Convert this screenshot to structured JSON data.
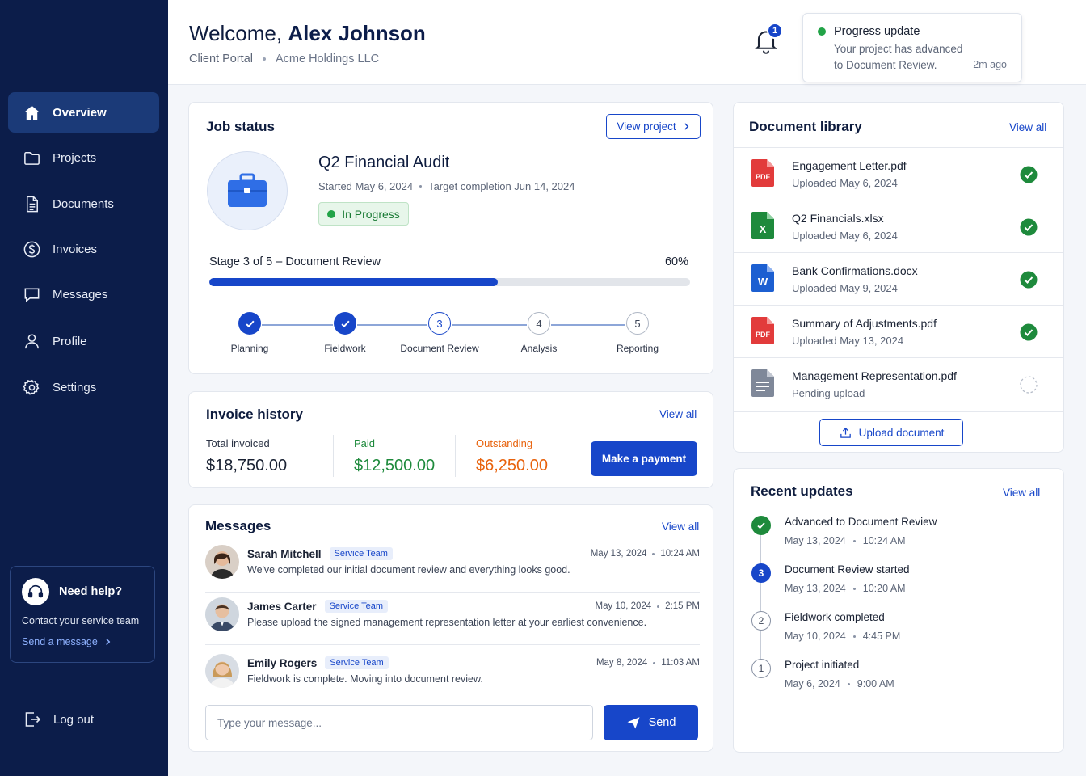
{
  "header": {
    "welcome_prefix": "Welcome,",
    "user_name": "Alex Johnson",
    "portal": "Client Portal",
    "company": "Acme Holdings LLC",
    "notification_count": "1"
  },
  "toast": {
    "title": "Progress update",
    "body": "Your project has advanced to Document Review.",
    "time": "2m ago"
  },
  "sidebar": {
    "items": [
      {
        "label": "Overview",
        "icon": "home-icon"
      },
      {
        "label": "Projects",
        "icon": "folder-icon"
      },
      {
        "label": "Documents",
        "icon": "document-icon"
      },
      {
        "label": "Invoices",
        "icon": "dollar-icon"
      },
      {
        "label": "Messages",
        "icon": "chat-icon"
      },
      {
        "label": "Profile",
        "icon": "user-icon"
      },
      {
        "label": "Settings",
        "icon": "gear-icon"
      }
    ],
    "help_title": "Need help?",
    "help_text": "Contact your service team",
    "help_link": "Send a message",
    "logout": "Log out"
  },
  "job": {
    "title": "Job status",
    "view_project": "View project",
    "name": "Q2 Financial Audit",
    "started": "Started May 6, 2024",
    "target": "Target completion Jun 14, 2024",
    "status": "In Progress",
    "stage": "Stage 3 of 5 – Document Review",
    "percent_label": "60%",
    "progress": 0.6,
    "steps": [
      {
        "label": "Planning",
        "num": "1",
        "state": "done"
      },
      {
        "label": "Fieldwork",
        "num": "2",
        "state": "done"
      },
      {
        "label": "Document Review",
        "num": "3",
        "state": "current"
      },
      {
        "label": "Analysis",
        "num": "4",
        "state": "todo"
      },
      {
        "label": "Reporting",
        "num": "5",
        "state": "todo"
      }
    ]
  },
  "invoice": {
    "title": "Invoice history",
    "view_all": "View all",
    "total_label": "Total invoiced",
    "total_value": "$18,750.00",
    "paid_label": "Paid",
    "paid_value": "$12,500.00",
    "outstanding_label": "Outstanding",
    "outstanding_value": "$6,250.00",
    "pay_button": "Make a payment",
    "colors": {
      "paid": "#1e8a3c",
      "outstanding": "#e8620c"
    }
  },
  "messages": {
    "title": "Messages",
    "view_all": "View all",
    "items": [
      {
        "name": "Sarah Mitchell",
        "tag": "Service Team",
        "date": "May 13, 2024",
        "time": "10:24 AM",
        "text": "We've completed our initial document review and everything looks good."
      },
      {
        "name": "James Carter",
        "tag": "Service Team",
        "date": "May 10, 2024",
        "time": "2:15 PM",
        "text": "Please upload the signed management representation letter at your earliest convenience."
      },
      {
        "name": "Emily Rogers",
        "tag": "Service Team",
        "date": "May 8, 2024",
        "time": "11:03 AM",
        "text": "Fieldwork is complete. Moving into document review."
      }
    ],
    "input_placeholder": "Type your message...",
    "send": "Send"
  },
  "documents": {
    "title": "Document library",
    "view_all": "View all",
    "items": [
      {
        "name": "Engagement Letter.pdf",
        "sub": "Uploaded May 6, 2024",
        "type": "pdf",
        "done": true
      },
      {
        "name": "Q2 Financials.xlsx",
        "sub": "Uploaded May 6, 2024",
        "type": "xlsx",
        "done": true
      },
      {
        "name": "Bank Confirmations.docx",
        "sub": "Uploaded May 9, 2024",
        "type": "docx",
        "done": true
      },
      {
        "name": "Summary of Adjustments.pdf",
        "sub": "Uploaded May 13, 2024",
        "type": "pdf",
        "done": true
      },
      {
        "name": "Management Representation.pdf",
        "sub": "Pending upload",
        "type": "file",
        "done": false
      }
    ],
    "upload": "Upload document",
    "icon_text": {
      "pdf": "PDF",
      "xlsx": "X",
      "docx": "W"
    }
  },
  "updates": {
    "title": "Recent updates",
    "view_all": "View all",
    "items": [
      {
        "title": "Advanced to Document Review",
        "date": "May 13, 2024",
        "time": "10:24 AM",
        "state": "done",
        "num": ""
      },
      {
        "title": "Document Review started",
        "date": "May 13, 2024",
        "time": "10:20 AM",
        "state": "current",
        "num": "3"
      },
      {
        "title": "Fieldwork completed",
        "date": "May 10, 2024",
        "time": "4:45 PM",
        "state": "past",
        "num": "2"
      },
      {
        "title": "Project initiated",
        "date": "May 6, 2024",
        "time": "9:00 AM",
        "state": "past",
        "num": "1"
      }
    ]
  }
}
